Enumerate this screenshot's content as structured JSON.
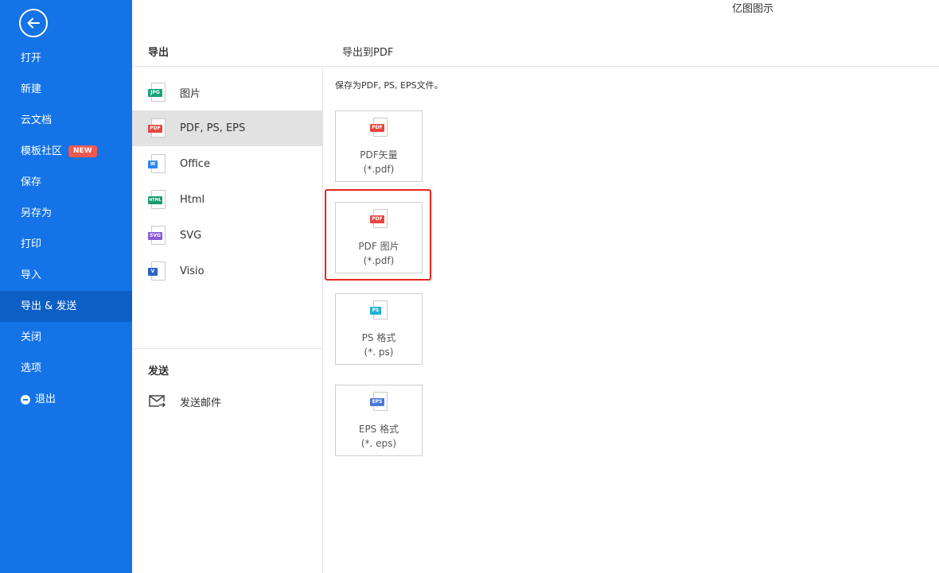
{
  "app_title": "亿图图示",
  "sidebar": {
    "back_icon": "arrow-left-icon",
    "items": [
      {
        "label": "打开"
      },
      {
        "label": "新建"
      },
      {
        "label": "云文档"
      },
      {
        "label": "模板社区",
        "badge": "NEW"
      },
      {
        "label": "保存"
      },
      {
        "label": "另存为"
      },
      {
        "label": "打印"
      },
      {
        "label": "导入"
      },
      {
        "label": "导出 & 发送",
        "active": true
      },
      {
        "label": "关闭"
      },
      {
        "label": "选项"
      },
      {
        "label": "退出",
        "icon": "minus-circle-icon"
      }
    ]
  },
  "export_section": {
    "title": "导出",
    "items": [
      {
        "label": "图片",
        "icon": "jpg-file-icon",
        "tag": "JPG",
        "color": "#1aa37a"
      },
      {
        "label": "PDF, PS, EPS",
        "icon": "pdf-file-icon",
        "tag": "PDF",
        "color": "#e6463f",
        "selected": true
      },
      {
        "label": "Office",
        "icon": "word-file-icon",
        "tag": "W",
        "color": "#2f86e8"
      },
      {
        "label": "Html",
        "icon": "html-file-icon",
        "tag": "HTML",
        "color": "#1a9a6e"
      },
      {
        "label": "SVG",
        "icon": "svg-file-icon",
        "tag": "SVG",
        "color": "#8a5bd6"
      },
      {
        "label": "Visio",
        "icon": "visio-file-icon",
        "tag": "V",
        "color": "#2b63c9"
      }
    ]
  },
  "send_section": {
    "title": "发送",
    "mail_label": "发送邮件",
    "mail_icon": "mail-send-icon"
  },
  "right_panel": {
    "title": "导出到PDF",
    "description": "保存为PDF, PS, EPS文件。",
    "cards": [
      {
        "name": "PDF矢量",
        "ext": "(*.pdf)",
        "tag": "PDF",
        "color": "#e6463f"
      },
      {
        "name": "PDF 图片",
        "ext": "(*.pdf)",
        "tag": "PDF",
        "color": "#e6463f",
        "highlighted": true
      },
      {
        "name": "PS 格式",
        "ext": "(*. ps)",
        "tag": "PS",
        "color": "#21b2d6"
      },
      {
        "name": "EPS 格式",
        "ext": "(*. eps)",
        "tag": "EPS",
        "color": "#4a78d6"
      }
    ]
  },
  "colors": {
    "sidebar": "#1473e6",
    "sidebar_active": "#0d5fc4",
    "badge": "#f0584f",
    "highlight": "#e8261e"
  }
}
